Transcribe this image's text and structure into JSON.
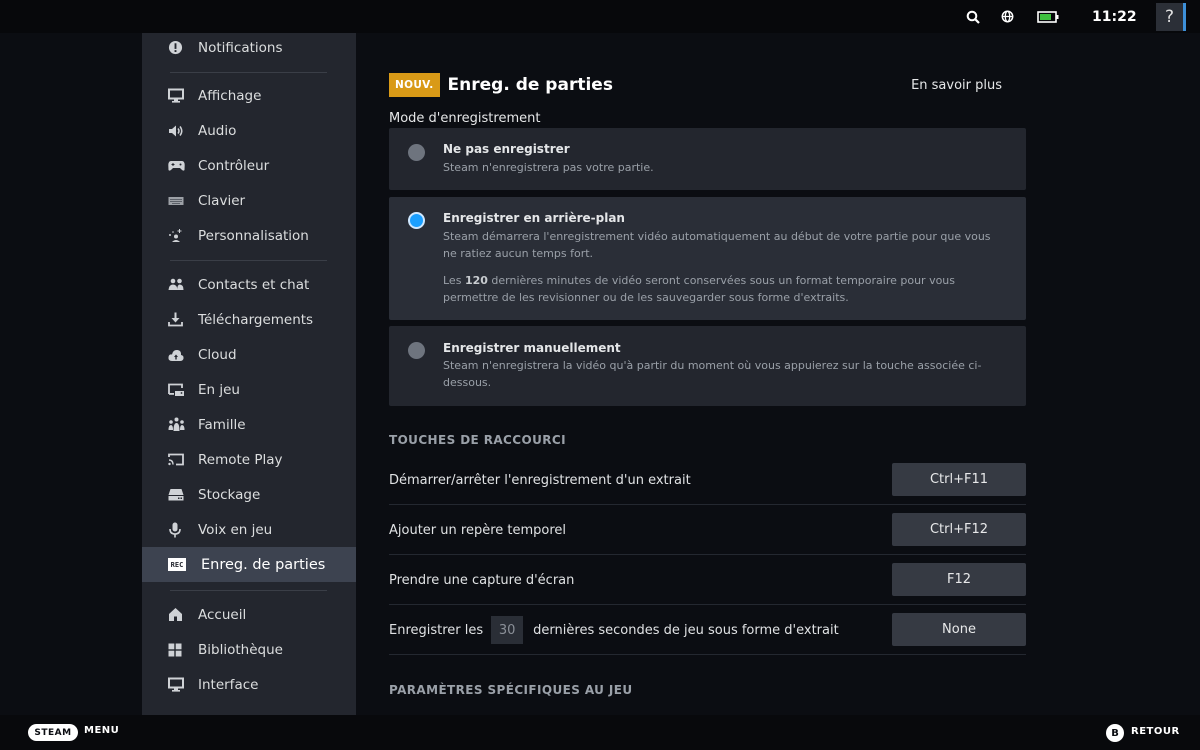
{
  "topbar": {
    "icons": [
      "search-icon",
      "globe-icon",
      "battery-icon"
    ],
    "time": "11:22",
    "help_label": "?",
    "battery_color": "#3ec13e"
  },
  "sidebar": {
    "items": [
      {
        "label": "Notifications",
        "icon": "notification-icon"
      },
      {
        "label": "Affichage",
        "icon": "display-icon"
      },
      {
        "label": "Audio",
        "icon": "speaker-icon"
      },
      {
        "label": "Contrôleur",
        "icon": "controller-icon"
      },
      {
        "label": "Clavier",
        "icon": "keyboard-icon"
      },
      {
        "label": "Personnalisation",
        "icon": "customization-icon"
      },
      {
        "label": "Contacts et chat",
        "icon": "friends-icon"
      },
      {
        "label": "Téléchargements",
        "icon": "download-icon"
      },
      {
        "label": "Cloud",
        "icon": "cloud-icon"
      },
      {
        "label": "En jeu",
        "icon": "in-game-icon"
      },
      {
        "label": "Famille",
        "icon": "family-icon"
      },
      {
        "label": "Remote Play",
        "icon": "cast-icon"
      },
      {
        "label": "Stockage",
        "icon": "storage-icon"
      },
      {
        "label": "Voix en jeu",
        "icon": "microphone-icon"
      },
      {
        "label": "Enreg. de parties",
        "icon": "rec-icon",
        "active": true
      },
      {
        "label": "Accueil",
        "icon": "home-icon"
      },
      {
        "label": "Bibliothèque",
        "icon": "library-icon"
      },
      {
        "label": "Interface",
        "icon": "monitor-icon"
      }
    ],
    "rec_icon_text": "REC"
  },
  "main": {
    "badge": "NOUV.",
    "title": "Enreg. de parties",
    "learn_more": "En savoir plus",
    "mode_label": "Mode d'enregistrement",
    "accent_color": "#1a9fff",
    "options": [
      {
        "title": "Ne pas enregistrer",
        "desc": "Steam n'enregistrera pas votre partie.",
        "selected": false
      },
      {
        "title": "Enregistrer en arrière-plan",
        "desc": "Steam démarrera l'enregistrement vidéo automatiquement au début de votre partie pour que vous ne ratiez aucun temps fort.",
        "desc2_prefix": "Les ",
        "desc2_minutes": "120",
        "desc2_suffix": " dernières minutes de vidéo seront conservées sous un format temporaire pour vous permettre de les revisionner ou de les sauvegarder sous forme d'extraits.",
        "selected": true
      },
      {
        "title": "Enregistrer manuellement",
        "desc": "Steam n'enregistrera la vidéo qu'à partir du moment où vous appuierez sur la touche associée ci-dessous.",
        "selected": false
      }
    ],
    "hotkeys_heading": "TOUCHES DE RACCOURCI",
    "hotkeys": [
      {
        "label": "Démarrer/arrêter l'enregistrement d'un extrait",
        "key": "Ctrl+F11"
      },
      {
        "label": "Ajouter un repère temporel",
        "key": "Ctrl+F12"
      },
      {
        "label": "Prendre une capture d'écran",
        "key": "F12"
      }
    ],
    "clip_row": {
      "prefix": "Enregistrer les",
      "seconds_value": "30",
      "suffix": "dernières secondes de jeu sous forme d'extrait",
      "key": "None"
    },
    "game_settings_heading": "PARAMÈTRES SPÉCIFIQUES AU JEU"
  },
  "bottombar": {
    "steam_label": "STEAM",
    "menu_label": "MENU",
    "b_label": "B",
    "back_label": "RETOUR"
  }
}
